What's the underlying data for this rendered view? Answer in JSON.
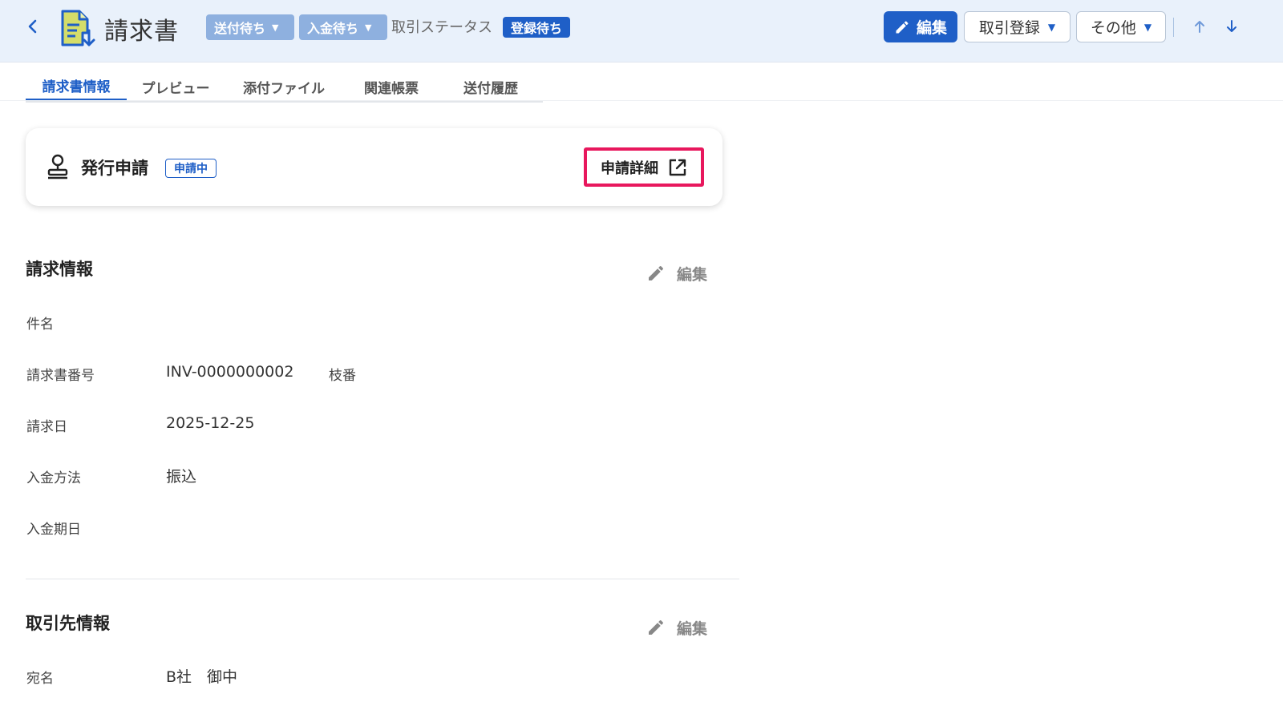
{
  "header": {
    "title": "請求書",
    "send_status": "送付待ち",
    "payment_status": "入金待ち",
    "deal_status_label": "取引ステータス",
    "deal_status": "登録待ち",
    "edit_label": "編集",
    "register_label": "取引登録",
    "more_label": "その他"
  },
  "tabs": [
    {
      "label": "請求書情報",
      "active": true
    },
    {
      "label": "プレビュー"
    },
    {
      "label": "添付ファイル"
    },
    {
      "label": "関連帳票"
    },
    {
      "label": "送付履歴"
    }
  ],
  "approval": {
    "title": "発行申請",
    "status": "申請中",
    "detail_label": "申請詳細"
  },
  "billing": {
    "title": "請求情報",
    "edit_label": "編集",
    "fields": [
      {
        "label": "件名",
        "value": ""
      },
      {
        "label": "請求書番号",
        "value": "INV-0000000002",
        "extra_label": "枝番"
      },
      {
        "label": "請求日",
        "value": "2025-12-25"
      },
      {
        "label": "入金方法",
        "value": "振込"
      },
      {
        "label": "入金期日",
        "value": ""
      }
    ]
  },
  "client": {
    "title": "取引先情報",
    "edit_label": "編集",
    "fields": [
      {
        "label": "宛名",
        "value": "B社　御中"
      }
    ]
  },
  "colors": {
    "accent": "#1f5fc7",
    "highlight": "#e8175d",
    "header_bg": "#e9f1fb"
  }
}
